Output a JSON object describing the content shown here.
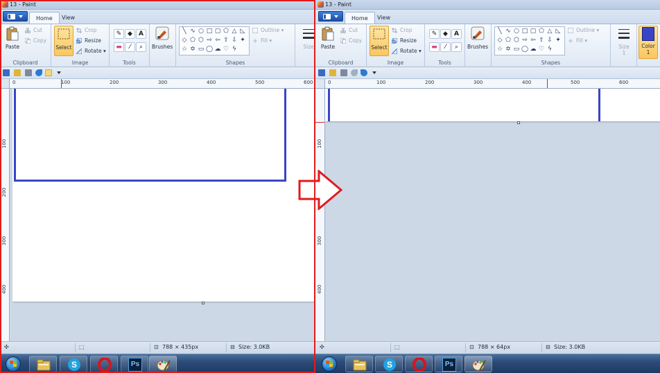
{
  "left": {
    "title": "13 - Paint",
    "tabs": [
      {
        "label": "Home"
      },
      {
        "label": "View"
      }
    ],
    "ribbon": {
      "clipboard": {
        "paste": "Paste",
        "cut": "Cut",
        "copy": "Copy",
        "group": "Clipboard"
      },
      "image": {
        "select": "Select",
        "crop": "Crop",
        "resize": "Resize",
        "rotate": "Rotate",
        "group": "Image"
      },
      "tools": {
        "group": "Tools",
        "text_tool": "A"
      },
      "brushes": {
        "label": "Brushes"
      },
      "shapes": {
        "outline": "Outline",
        "fill": "Fill",
        "group": "Shapes"
      },
      "size": {
        "label": "Size"
      }
    },
    "ruler_h": [
      "0",
      "100",
      "200",
      "300",
      "400",
      "500",
      "600"
    ],
    "ruler_v": [
      "100",
      "200",
      "300",
      "400"
    ],
    "status": {
      "dimensions": "788 × 435px",
      "size": "Size: 3.0KB"
    }
  },
  "right": {
    "title": "13 - Paint",
    "tabs": [
      {
        "label": "Home"
      },
      {
        "label": "View"
      }
    ],
    "ribbon": {
      "clipboard": {
        "paste": "Paste",
        "cut": "Cut",
        "copy": "Copy",
        "group": "Clipboard"
      },
      "image": {
        "select": "Select",
        "crop": "Crop",
        "resize": "Resize",
        "rotate": "Rotate",
        "group": "Image"
      },
      "tools": {
        "group": "Tools",
        "text_tool": "A"
      },
      "brushes": {
        "label": "Brushes"
      },
      "shapes": {
        "outline": "Outline",
        "fill": "Fill",
        "group": "Shapes"
      },
      "size": {
        "label": "Size",
        "value": "1"
      },
      "color1": {
        "label": "Color",
        "value": "1"
      }
    },
    "ruler_h": [
      "0",
      "100",
      "200",
      "300",
      "400",
      "500",
      "600"
    ],
    "ruler_v": [
      "100",
      "200",
      "300",
      "400"
    ],
    "status": {
      "dimensions": "788 × 64px",
      "size": "Size: 3.0KB"
    }
  },
  "taskbar": {
    "apps": [
      {
        "name": "explorer-icon"
      },
      {
        "name": "skype-icon"
      },
      {
        "name": "opera-icon"
      },
      {
        "name": "photoshop-icon",
        "label": "Ps"
      },
      {
        "name": "paint-icon"
      }
    ]
  },
  "colors": {
    "accent_red": "#e11b1b",
    "rect_blue": "#3945c5",
    "select_highlight": "#fbc75e"
  }
}
